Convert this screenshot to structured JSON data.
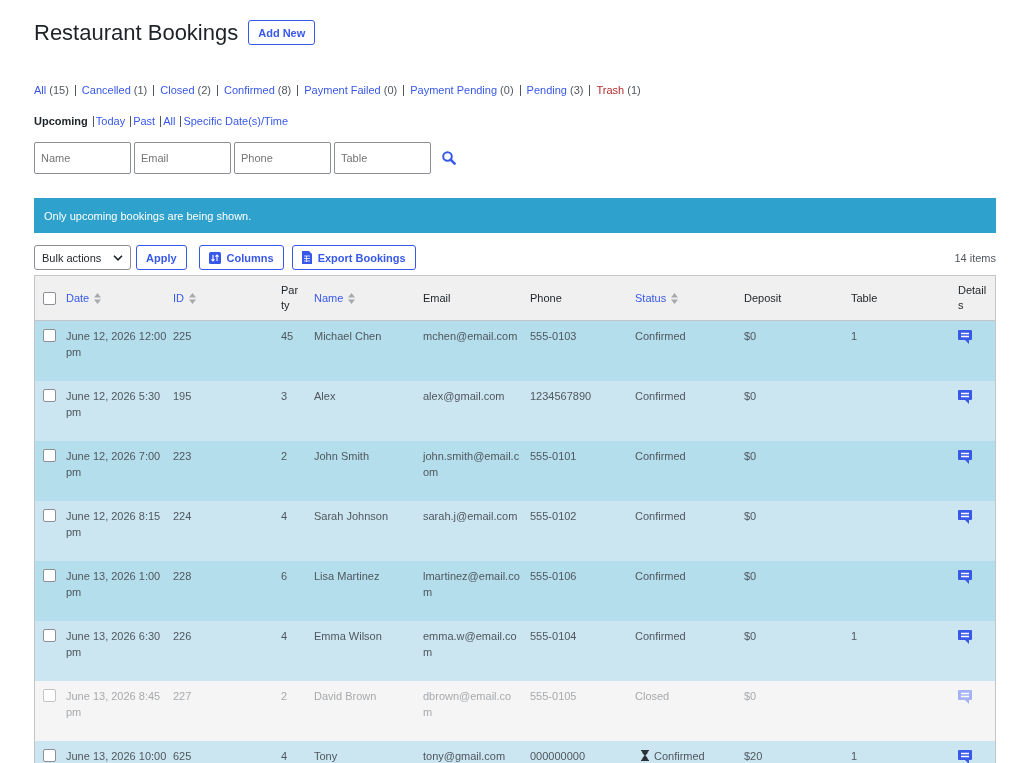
{
  "page": {
    "title": "Restaurant Bookings",
    "add_button": "Add New"
  },
  "status_filters": [
    {
      "label": "All",
      "count": "(15)",
      "kind": "status"
    },
    {
      "label": "Cancelled",
      "count": "(1)",
      "kind": "status"
    },
    {
      "label": "Closed",
      "count": "(2)",
      "kind": "status"
    },
    {
      "label": "Confirmed",
      "count": "(8)",
      "kind": "status"
    },
    {
      "label": "Payment Failed",
      "count": "(0)",
      "kind": "status"
    },
    {
      "label": "Payment Pending",
      "count": "(0)",
      "kind": "status"
    },
    {
      "label": "Pending",
      "count": "(3)",
      "kind": "status"
    },
    {
      "label": "Trash",
      "count": "(1)",
      "kind": "trash"
    }
  ],
  "date_filters": [
    {
      "label": "Upcoming",
      "selected": true
    },
    {
      "label": "Today",
      "selected": false
    },
    {
      "label": "Past",
      "selected": false
    },
    {
      "label": "All",
      "selected": false
    },
    {
      "label": "Specific Date(s)/Time",
      "selected": false
    }
  ],
  "search": {
    "fields": [
      {
        "placeholder": "Name"
      },
      {
        "placeholder": "Email"
      },
      {
        "placeholder": "Phone"
      },
      {
        "placeholder": "Table"
      }
    ]
  },
  "notice": "Only upcoming bookings are being shown.",
  "toolbar": {
    "bulk_actions": "Bulk actions",
    "apply": "Apply",
    "columns": "Columns",
    "export": "Export Bookings",
    "item_count": "14 items"
  },
  "table": {
    "select_all_checked": false,
    "columns": [
      {
        "label": "Date",
        "sortable": true
      },
      {
        "label": "ID",
        "sortable": true
      },
      {
        "label": "Party",
        "sortable": false
      },
      {
        "label": "Name",
        "sortable": true
      },
      {
        "label": "Email",
        "sortable": false
      },
      {
        "label": "Phone",
        "sortable": false
      },
      {
        "label": "Status",
        "sortable": true
      },
      {
        "label": "Deposit",
        "sortable": false
      },
      {
        "label": "Table",
        "sortable": false
      },
      {
        "label": "Details",
        "sortable": false
      }
    ],
    "rows": [
      {
        "checked": false,
        "dimmed": false,
        "hourglass": false,
        "date": "June 12, 2026 12:00 pm",
        "id": "225",
        "party": "45",
        "name": "Michael Chen",
        "email": "mchen@email.com",
        "phone": "555-0103",
        "status": "Confirmed",
        "deposit": "$0",
        "table": "1"
      },
      {
        "checked": false,
        "dimmed": false,
        "hourglass": false,
        "date": "June 12, 2026 5:30 pm",
        "id": "195",
        "party": "3",
        "name": "Alex",
        "email": "alex@gmail.com",
        "phone": "1234567890",
        "status": "Confirmed",
        "deposit": "$0"
      },
      {
        "checked": false,
        "dimmed": false,
        "hourglass": false,
        "date": "June 12, 2026 7:00 pm",
        "id": "223",
        "party": "2",
        "name": "John Smith",
        "email": "john.smith@email.com",
        "phone": "555-0101",
        "status": "Confirmed",
        "deposit": "$0"
      },
      {
        "checked": false,
        "dimmed": false,
        "hourglass": false,
        "date": "June 12, 2026 8:15 pm",
        "id": "224",
        "party": "4",
        "name": "Sarah Johnson",
        "email": "sarah.j@email.com",
        "phone": "555-0102",
        "status": "Confirmed",
        "deposit": "$0"
      },
      {
        "checked": false,
        "dimmed": false,
        "hourglass": false,
        "date": "June 13, 2026 1:00 pm",
        "id": "228",
        "party": "6",
        "name": "Lisa Martinez",
        "email": "lmartinez@email.com",
        "phone": "555-0106",
        "status": "Confirmed",
        "deposit": "$0"
      },
      {
        "checked": false,
        "dimmed": false,
        "hourglass": false,
        "date": "June 13, 2026 6:30 pm",
        "id": "226",
        "party": "4",
        "name": "Emma Wilson",
        "email": "emma.w@email.com",
        "phone": "555-0104",
        "status": "Confirmed",
        "deposit": "$0",
        "table": "1"
      },
      {
        "checked": false,
        "dimmed": true,
        "hourglass": false,
        "date": "June 13, 2026 8:45 pm",
        "id": "227",
        "party": "2",
        "name": "David Brown",
        "email": "dbrown@email.com",
        "phone": "555-0105",
        "status": "Closed",
        "deposit": "$0"
      },
      {
        "checked": false,
        "dimmed": false,
        "hourglass": true,
        "date": "June 13, 2026 10:00",
        "id": "625",
        "party": "4",
        "name": "Tony",
        "email": "tony@gmail.com",
        "phone": "000000000",
        "status": "Confirmed",
        "deposit": "$20",
        "table": "1"
      }
    ]
  }
}
